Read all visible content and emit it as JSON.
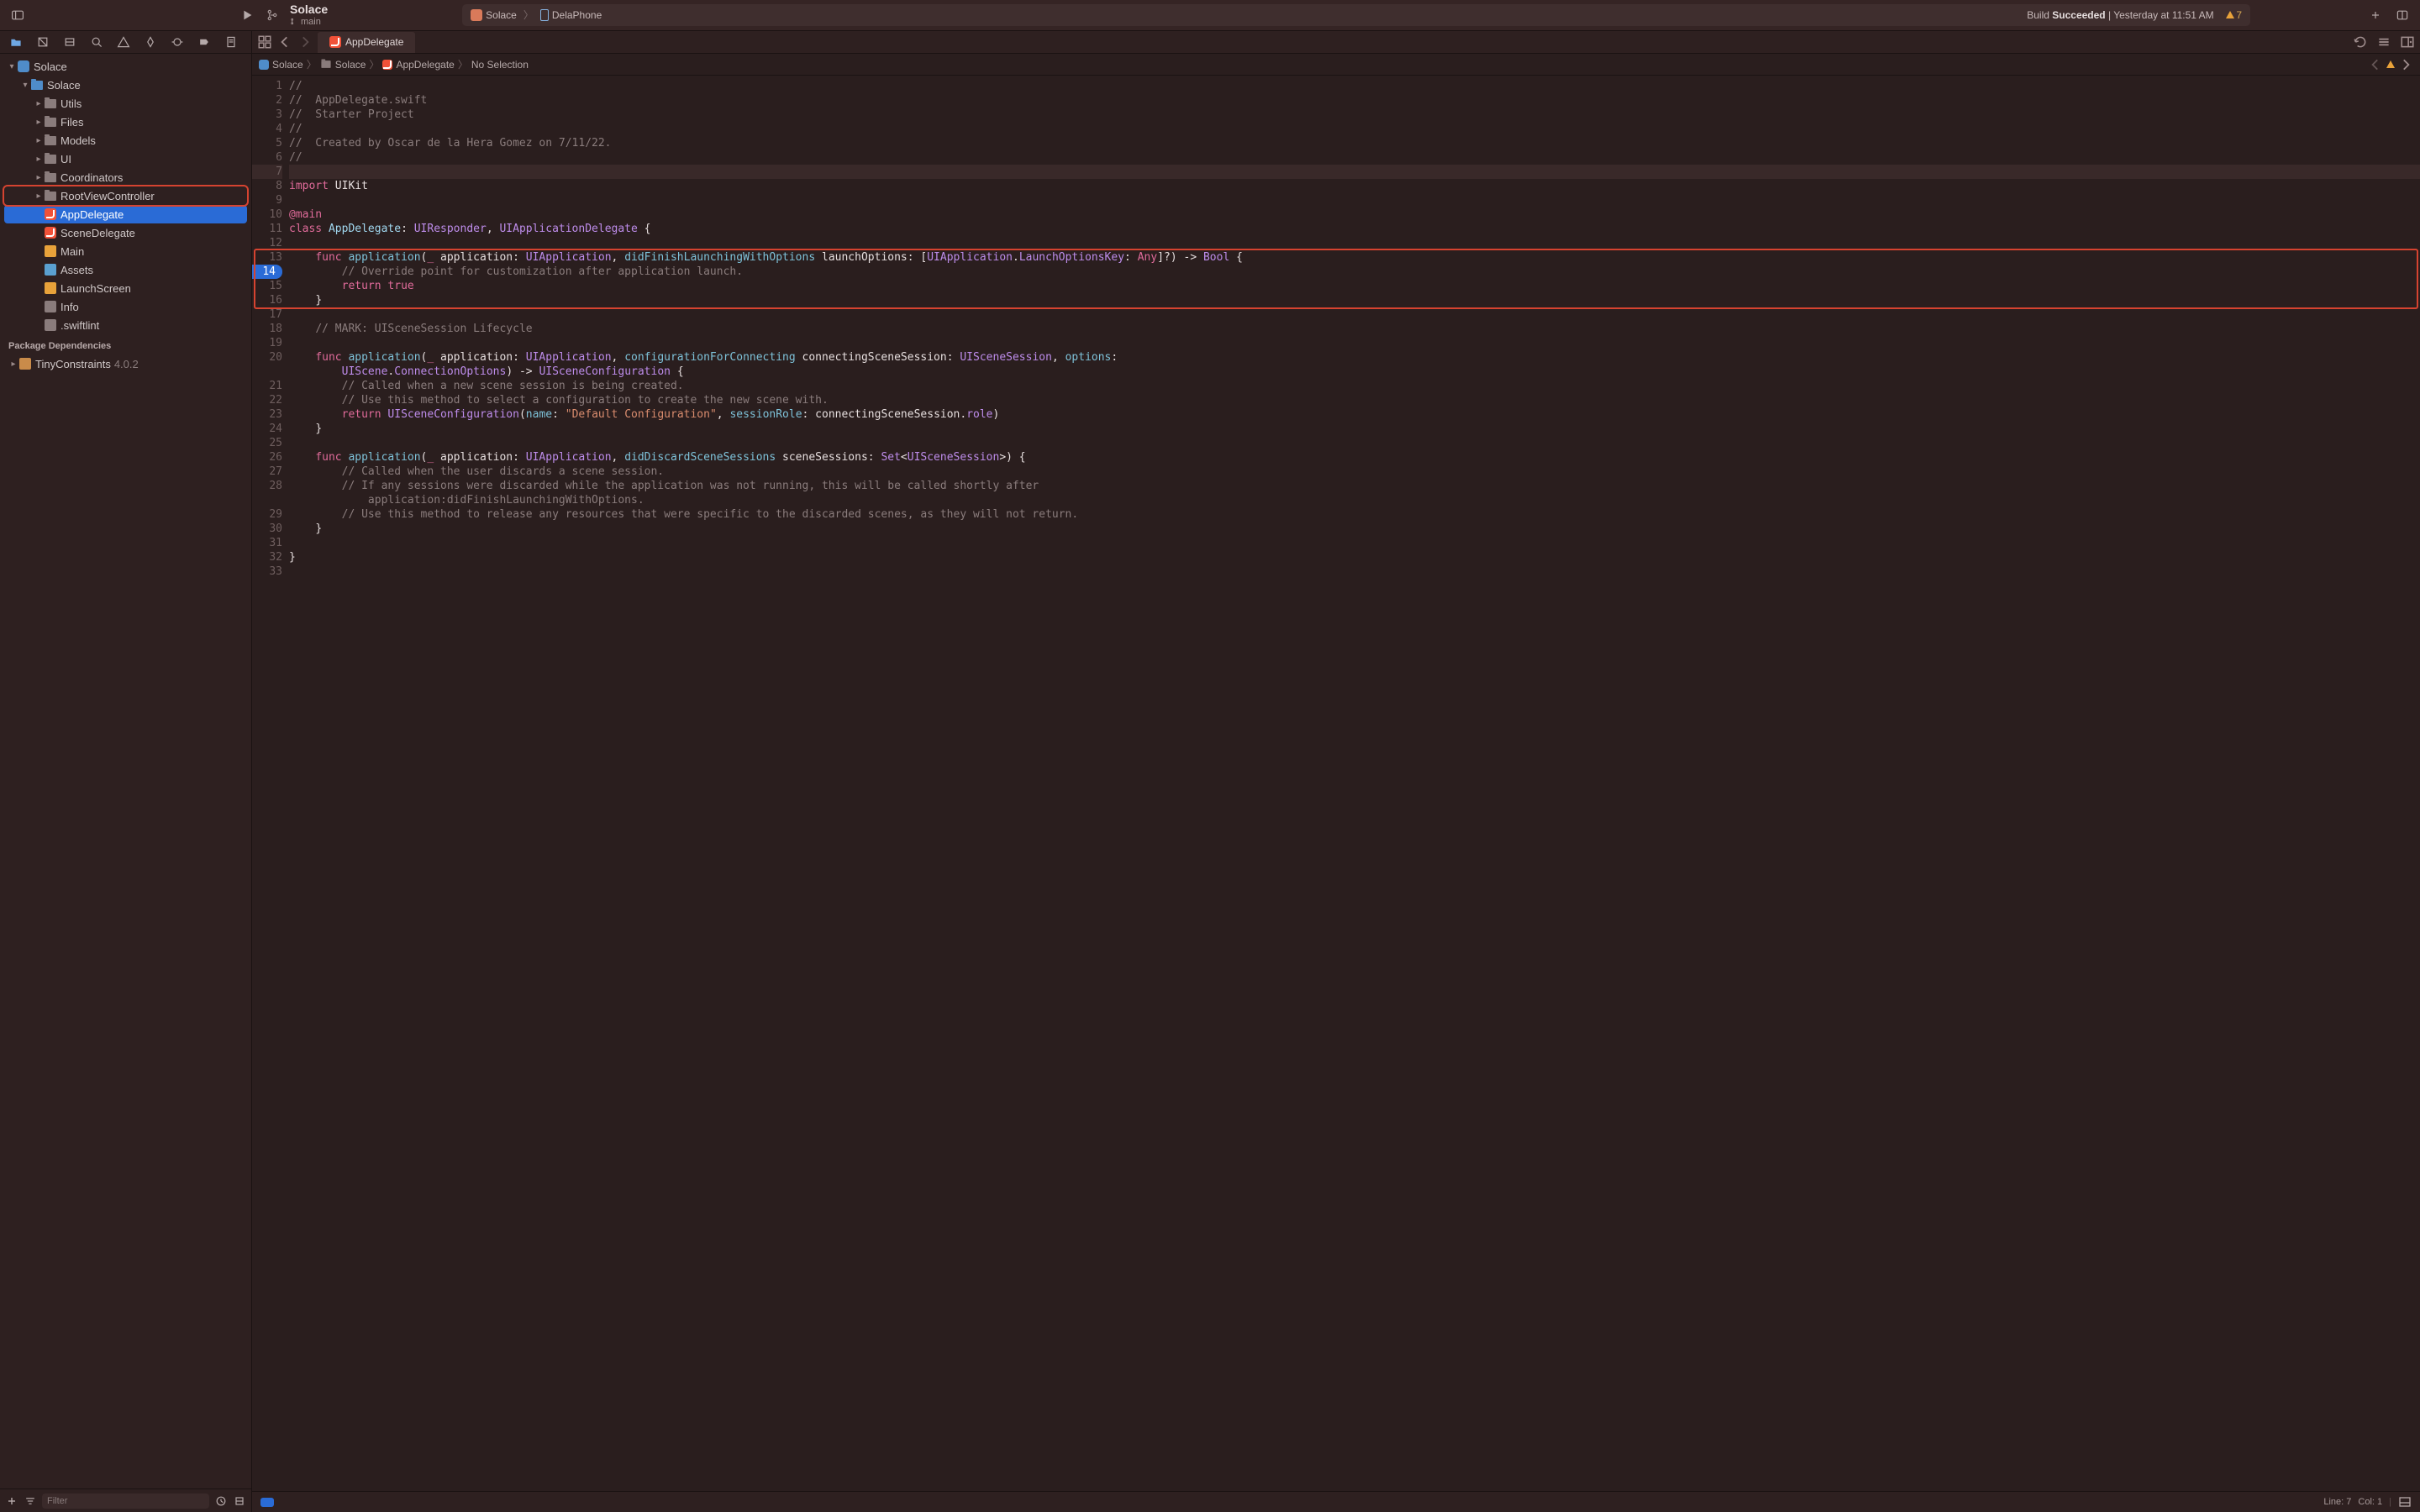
{
  "toolbar": {
    "scheme_name": "Solace",
    "branch": "main",
    "activity_scheme": "Solace",
    "activity_device": "DelaPhone",
    "build_prefix": "Build",
    "build_status": "Succeeded",
    "build_time": "Yesterday at 11:51 AM",
    "warning_count": "7"
  },
  "navigator": {
    "project": "Solace",
    "groups": [
      {
        "name": "Solace",
        "level": 1,
        "type": "folder",
        "expanded": true
      },
      {
        "name": "Utils",
        "level": 2,
        "type": "folder-gray"
      },
      {
        "name": "Files",
        "level": 2,
        "type": "folder-gray"
      },
      {
        "name": "Models",
        "level": 2,
        "type": "folder-gray"
      },
      {
        "name": "UI",
        "level": 2,
        "type": "folder-gray"
      },
      {
        "name": "Coordinators",
        "level": 2,
        "type": "folder-gray"
      },
      {
        "name": "RootViewController",
        "level": 2,
        "type": "folder-gray",
        "hl": true
      },
      {
        "name": "AppDelegate",
        "level": 2,
        "type": "swift",
        "selected": true
      },
      {
        "name": "SceneDelegate",
        "level": 2,
        "type": "swift"
      },
      {
        "name": "Main",
        "level": 2,
        "type": "xib"
      },
      {
        "name": "Assets",
        "level": 2,
        "type": "assets"
      },
      {
        "name": "LaunchScreen",
        "level": 2,
        "type": "xib"
      },
      {
        "name": "Info",
        "level": 2,
        "type": "plist"
      },
      {
        "name": ".swiftlint",
        "level": 2,
        "type": "plist"
      }
    ],
    "deps_label": "Package Dependencies",
    "deps": [
      {
        "name": "TinyConstraints",
        "version": "4.0.2"
      }
    ],
    "filter_placeholder": "Filter"
  },
  "tab": {
    "title": "AppDelegate"
  },
  "jumpbar": {
    "items": [
      "Solace",
      "Solace",
      "AppDelegate",
      "No Selection"
    ]
  },
  "status": {
    "line_label": "Line:",
    "line": "7",
    "col_label": "Col:",
    "col": "1"
  },
  "highlight": {
    "top_line": 13,
    "bottom_line": 16
  },
  "code": [
    {
      "n": 1,
      "html": "<span class='cm'>//</span>"
    },
    {
      "n": 2,
      "html": "<span class='cm'>//  AppDelegate.swift</span>"
    },
    {
      "n": 3,
      "html": "<span class='cm'>//  Starter Project</span>"
    },
    {
      "n": 4,
      "html": "<span class='cm'>//</span>"
    },
    {
      "n": 5,
      "html": "<span class='cm'>//  Created by Oscar de la Hera Gomez on 7/11/22.</span>"
    },
    {
      "n": 6,
      "html": "<span class='cm'>//</span>"
    },
    {
      "n": 7,
      "html": "",
      "cursor": true
    },
    {
      "n": 8,
      "html": "<span class='kw'>import</span> <span class='pl'>UIKit</span>"
    },
    {
      "n": 9,
      "html": ""
    },
    {
      "n": 10,
      "html": "<span class='attr'>@main</span>"
    },
    {
      "n": 11,
      "html": "<span class='kw'>class</span> <span class='ty'>AppDelegate</span><span class='pl'>: </span><span class='ty2'>UIResponder</span><span class='pl'>, </span><span class='ty2'>UIApplicationDelegate</span><span class='pl'> {</span>"
    },
    {
      "n": 12,
      "html": ""
    },
    {
      "n": 13,
      "html": "    <span class='kw'>func</span> <span class='fn'>application</span><span class='pl'>(</span><span class='kw'>_</span> <span class='pl'>application: </span><span class='ty2'>UIApplication</span><span class='pl'>, </span><span class='arg'>didFinishLaunchingWithOptions</span> <span class='pl'>launchOptions: [</span><span class='ty2'>UIApplication</span><span class='pl'>.</span><span class='ty2'>LaunchOptionsKey</span><span class='pl'>: </span><span class='kw'>Any</span><span class='pl'>]?) -> </span><span class='ty2'>Bool</span><span class='pl'> {</span>"
    },
    {
      "n": 14,
      "html": "        <span class='cm'>// Override point for customization after application launch.</span>",
      "badge": true
    },
    {
      "n": 15,
      "html": "        <span class='kw'>return</span> <span class='kw'>true</span>"
    },
    {
      "n": 16,
      "html": "    <span class='pl'>}</span>"
    },
    {
      "n": 17,
      "html": ""
    },
    {
      "n": 18,
      "html": "    <span class='cm'>// MARK: UISceneSession Lifecycle</span>"
    },
    {
      "n": 19,
      "html": ""
    },
    {
      "n": 20,
      "html": "    <span class='kw'>func</span> <span class='fn'>application</span><span class='pl'>(</span><span class='kw'>_</span> <span class='pl'>application: </span><span class='ty2'>UIApplication</span><span class='pl'>, </span><span class='arg'>configurationForConnecting</span> <span class='pl'>connectingSceneSession: </span><span class='ty2'>UISceneSession</span><span class='pl'>, </span><span class='arg'>options</span><span class='pl'>:</span>"
    },
    {
      "n": "",
      "html": "        <span class='ty2'>UIScene</span><span class='pl'>.</span><span class='ty2'>ConnectionOptions</span><span class='pl'>) -> </span><span class='ty2'>UISceneConfiguration</span><span class='pl'> {</span>"
    },
    {
      "n": 21,
      "html": "        <span class='cm'>// Called when a new scene session is being created.</span>"
    },
    {
      "n": 22,
      "html": "        <span class='cm'>// Use this method to select a configuration to create the new scene with.</span>"
    },
    {
      "n": 23,
      "html": "        <span class='kw'>return</span> <span class='ty2'>UISceneConfiguration</span><span class='pl'>(</span><span class='arg'>name</span><span class='pl'>: </span><span class='str'>\"Default Configuration\"</span><span class='pl'>, </span><span class='arg'>sessionRole</span><span class='pl'>: connectingSceneSession.</span><span class='ty2'>role</span><span class='pl'>)</span>"
    },
    {
      "n": 24,
      "html": "    <span class='pl'>}</span>"
    },
    {
      "n": 25,
      "html": ""
    },
    {
      "n": 26,
      "html": "    <span class='kw'>func</span> <span class='fn'>application</span><span class='pl'>(</span><span class='kw'>_</span> <span class='pl'>application: </span><span class='ty2'>UIApplication</span><span class='pl'>, </span><span class='arg'>didDiscardSceneSessions</span> <span class='pl'>sceneSessions: </span><span class='ty2'>Set</span><span class='pl'>&lt;</span><span class='ty2'>UISceneSession</span><span class='pl'>&gt;) {</span>"
    },
    {
      "n": 27,
      "html": "        <span class='cm'>// Called when the user discards a scene session.</span>"
    },
    {
      "n": 28,
      "html": "        <span class='cm'>// If any sessions were discarded while the application was not running, this will be called shortly after</span>"
    },
    {
      "n": "",
      "html": "            <span class='cm'>application:didFinishLaunchingWithOptions.</span>"
    },
    {
      "n": 29,
      "html": "        <span class='cm'>// Use this method to release any resources that were specific to the discarded scenes, as they will not return.</span>"
    },
    {
      "n": 30,
      "html": "    <span class='pl'>}</span>"
    },
    {
      "n": 31,
      "html": ""
    },
    {
      "n": 32,
      "html": "<span class='pl'>}</span>"
    },
    {
      "n": 33,
      "html": ""
    }
  ]
}
